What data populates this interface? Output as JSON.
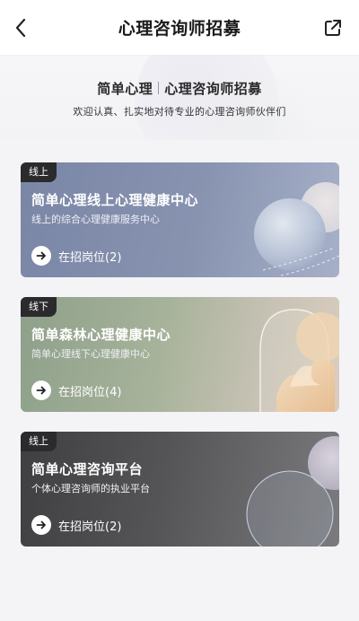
{
  "nav": {
    "title": "心理咨询师招募"
  },
  "hero": {
    "brand": "简单心理",
    "heading": "心理咨询师招募",
    "subtitle": "欢迎认真、扎实地对待专业的心理咨询师伙伴们"
  },
  "cards": [
    {
      "tag": "线上",
      "name": "简单心理线上心理健康中心",
      "desc": "线上的综合心理健康服务中心",
      "cta": "在招岗位(2)",
      "open_positions": 2
    },
    {
      "tag": "线下",
      "name": "简单森林心理健康中心",
      "desc": "简单心理线下心理健康中心",
      "cta": "在招岗位(4)",
      "open_positions": 4
    },
    {
      "tag": "线上",
      "name": "简单心理咨询平台",
      "desc": "个体心理咨询师的执业平台",
      "cta": "在招岗位(2)",
      "open_positions": 2
    }
  ],
  "icons": {
    "back": "chevron-left-icon",
    "share": "share-export-icon",
    "cta": "arrow-right-icon"
  },
  "colors": {
    "card_online": "#7a86a6",
    "card_offline": "#8ea08a",
    "card_platform": "#3f3f41",
    "tag_bg": "#2b2b2d"
  }
}
